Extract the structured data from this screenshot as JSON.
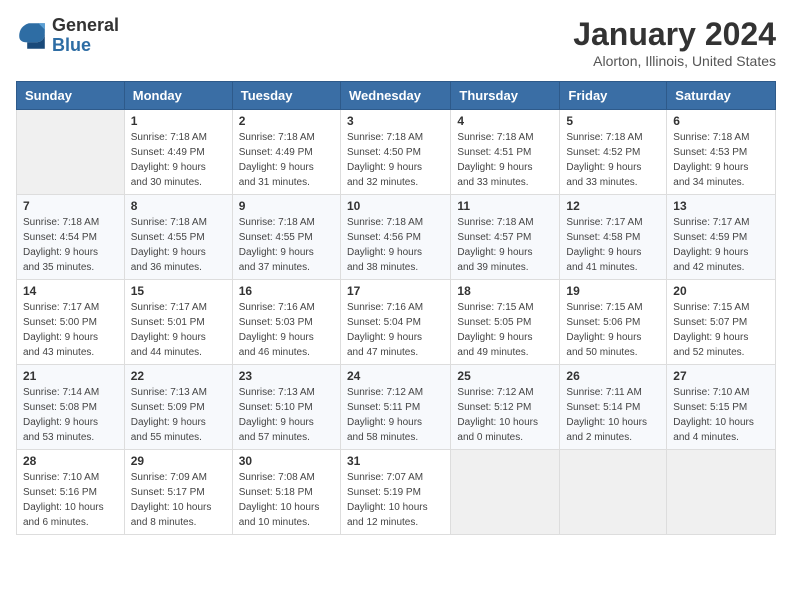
{
  "logo": {
    "general": "General",
    "blue": "Blue"
  },
  "title": "January 2024",
  "location": "Alorton, Illinois, United States",
  "weekdays": [
    "Sunday",
    "Monday",
    "Tuesday",
    "Wednesday",
    "Thursday",
    "Friday",
    "Saturday"
  ],
  "weeks": [
    [
      {
        "day": "",
        "info": ""
      },
      {
        "day": "1",
        "info": "Sunrise: 7:18 AM\nSunset: 4:49 PM\nDaylight: 9 hours\nand 30 minutes."
      },
      {
        "day": "2",
        "info": "Sunrise: 7:18 AM\nSunset: 4:49 PM\nDaylight: 9 hours\nand 31 minutes."
      },
      {
        "day": "3",
        "info": "Sunrise: 7:18 AM\nSunset: 4:50 PM\nDaylight: 9 hours\nand 32 minutes."
      },
      {
        "day": "4",
        "info": "Sunrise: 7:18 AM\nSunset: 4:51 PM\nDaylight: 9 hours\nand 33 minutes."
      },
      {
        "day": "5",
        "info": "Sunrise: 7:18 AM\nSunset: 4:52 PM\nDaylight: 9 hours\nand 33 minutes."
      },
      {
        "day": "6",
        "info": "Sunrise: 7:18 AM\nSunset: 4:53 PM\nDaylight: 9 hours\nand 34 minutes."
      }
    ],
    [
      {
        "day": "7",
        "info": "Sunrise: 7:18 AM\nSunset: 4:54 PM\nDaylight: 9 hours\nand 35 minutes."
      },
      {
        "day": "8",
        "info": "Sunrise: 7:18 AM\nSunset: 4:55 PM\nDaylight: 9 hours\nand 36 minutes."
      },
      {
        "day": "9",
        "info": "Sunrise: 7:18 AM\nSunset: 4:55 PM\nDaylight: 9 hours\nand 37 minutes."
      },
      {
        "day": "10",
        "info": "Sunrise: 7:18 AM\nSunset: 4:56 PM\nDaylight: 9 hours\nand 38 minutes."
      },
      {
        "day": "11",
        "info": "Sunrise: 7:18 AM\nSunset: 4:57 PM\nDaylight: 9 hours\nand 39 minutes."
      },
      {
        "day": "12",
        "info": "Sunrise: 7:17 AM\nSunset: 4:58 PM\nDaylight: 9 hours\nand 41 minutes."
      },
      {
        "day": "13",
        "info": "Sunrise: 7:17 AM\nSunset: 4:59 PM\nDaylight: 9 hours\nand 42 minutes."
      }
    ],
    [
      {
        "day": "14",
        "info": "Sunrise: 7:17 AM\nSunset: 5:00 PM\nDaylight: 9 hours\nand 43 minutes."
      },
      {
        "day": "15",
        "info": "Sunrise: 7:17 AM\nSunset: 5:01 PM\nDaylight: 9 hours\nand 44 minutes."
      },
      {
        "day": "16",
        "info": "Sunrise: 7:16 AM\nSunset: 5:03 PM\nDaylight: 9 hours\nand 46 minutes."
      },
      {
        "day": "17",
        "info": "Sunrise: 7:16 AM\nSunset: 5:04 PM\nDaylight: 9 hours\nand 47 minutes."
      },
      {
        "day": "18",
        "info": "Sunrise: 7:15 AM\nSunset: 5:05 PM\nDaylight: 9 hours\nand 49 minutes."
      },
      {
        "day": "19",
        "info": "Sunrise: 7:15 AM\nSunset: 5:06 PM\nDaylight: 9 hours\nand 50 minutes."
      },
      {
        "day": "20",
        "info": "Sunrise: 7:15 AM\nSunset: 5:07 PM\nDaylight: 9 hours\nand 52 minutes."
      }
    ],
    [
      {
        "day": "21",
        "info": "Sunrise: 7:14 AM\nSunset: 5:08 PM\nDaylight: 9 hours\nand 53 minutes."
      },
      {
        "day": "22",
        "info": "Sunrise: 7:13 AM\nSunset: 5:09 PM\nDaylight: 9 hours\nand 55 minutes."
      },
      {
        "day": "23",
        "info": "Sunrise: 7:13 AM\nSunset: 5:10 PM\nDaylight: 9 hours\nand 57 minutes."
      },
      {
        "day": "24",
        "info": "Sunrise: 7:12 AM\nSunset: 5:11 PM\nDaylight: 9 hours\nand 58 minutes."
      },
      {
        "day": "25",
        "info": "Sunrise: 7:12 AM\nSunset: 5:12 PM\nDaylight: 10 hours\nand 0 minutes."
      },
      {
        "day": "26",
        "info": "Sunrise: 7:11 AM\nSunset: 5:14 PM\nDaylight: 10 hours\nand 2 minutes."
      },
      {
        "day": "27",
        "info": "Sunrise: 7:10 AM\nSunset: 5:15 PM\nDaylight: 10 hours\nand 4 minutes."
      }
    ],
    [
      {
        "day": "28",
        "info": "Sunrise: 7:10 AM\nSunset: 5:16 PM\nDaylight: 10 hours\nand 6 minutes."
      },
      {
        "day": "29",
        "info": "Sunrise: 7:09 AM\nSunset: 5:17 PM\nDaylight: 10 hours\nand 8 minutes."
      },
      {
        "day": "30",
        "info": "Sunrise: 7:08 AM\nSunset: 5:18 PM\nDaylight: 10 hours\nand 10 minutes."
      },
      {
        "day": "31",
        "info": "Sunrise: 7:07 AM\nSunset: 5:19 PM\nDaylight: 10 hours\nand 12 minutes."
      },
      {
        "day": "",
        "info": ""
      },
      {
        "day": "",
        "info": ""
      },
      {
        "day": "",
        "info": ""
      }
    ]
  ]
}
